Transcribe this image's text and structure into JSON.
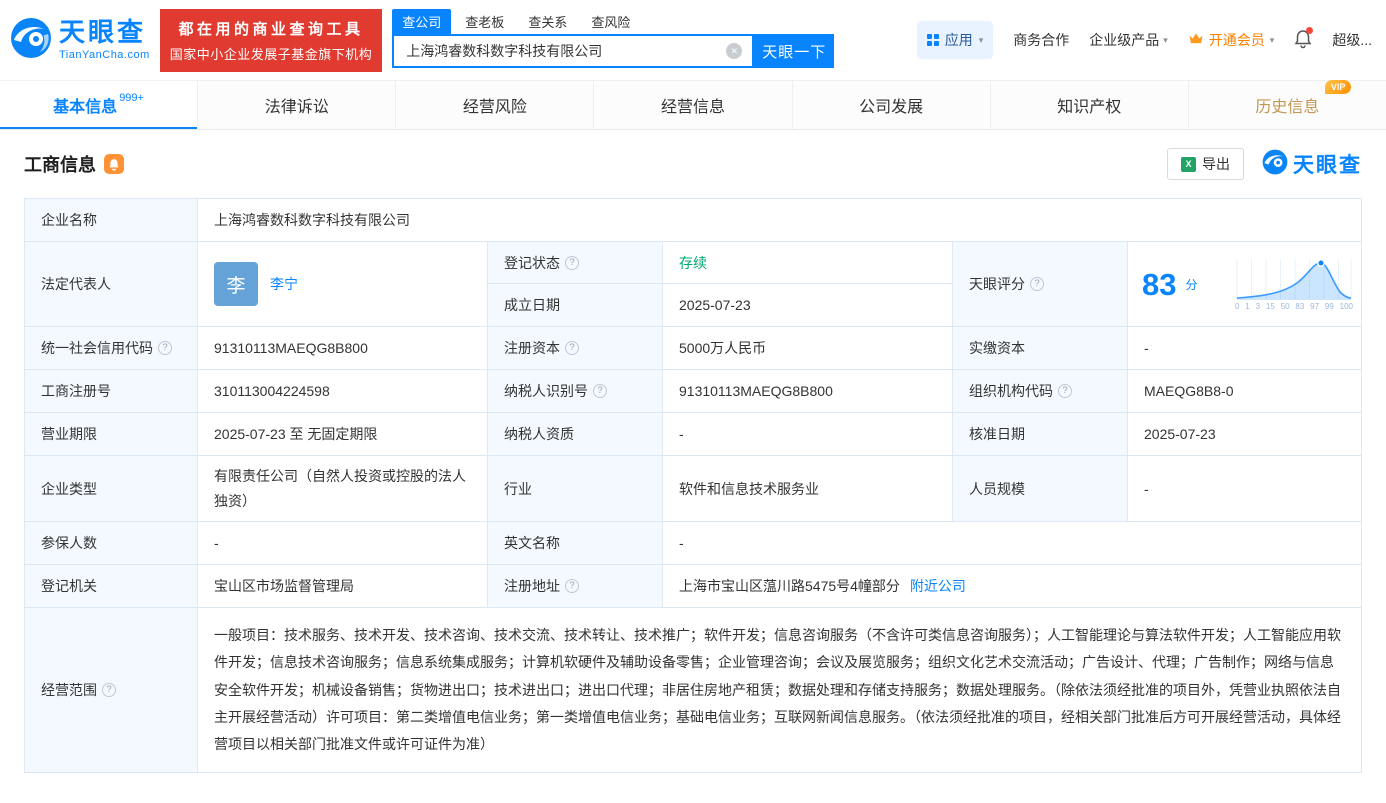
{
  "brand": {
    "name": "天眼查",
    "domain": "TianYanCha.com"
  },
  "promo": {
    "line1": "都在用的商业查询工具",
    "line2": "国家中小企业发展子基金旗下机构"
  },
  "search": {
    "tabs": [
      {
        "label": "查公司",
        "active": true
      },
      {
        "label": "查老板",
        "active": false
      },
      {
        "label": "查关系",
        "active": false
      },
      {
        "label": "查风险",
        "active": false
      }
    ],
    "value": "上海鸿睿数科数字科技有限公司",
    "button": "天眼一下"
  },
  "topmenu": {
    "apps": "应用",
    "cooperation": "商务合作",
    "enterprise": "企业级产品",
    "vip": "开通会员",
    "super": "超级..."
  },
  "nav": {
    "tabs": [
      {
        "label": "基本信息",
        "badge": "999+",
        "active": true
      },
      {
        "label": "法律诉讼"
      },
      {
        "label": "经营风险"
      },
      {
        "label": "经营信息"
      },
      {
        "label": "公司发展"
      },
      {
        "label": "知识产权"
      },
      {
        "label": "历史信息",
        "vip": "VIP"
      }
    ]
  },
  "section": {
    "title": "工商信息",
    "export": "导出",
    "brand": "天眼查"
  },
  "info": {
    "company_name": {
      "label": "企业名称",
      "value": "上海鸿睿数科数字科技有限公司"
    },
    "legal_rep": {
      "label": "法定代表人",
      "avatar": "李",
      "value": "李宁"
    },
    "reg_status": {
      "label": "登记状态",
      "value": "存续"
    },
    "establish_date": {
      "label": "成立日期",
      "value": "2025-07-23"
    },
    "score": {
      "label": "天眼评分",
      "value": "83",
      "unit": "分"
    },
    "credit_code": {
      "label": "统一社会信用代码",
      "value": "91310113MAEQG8B800"
    },
    "reg_capital": {
      "label": "注册资本",
      "value": "5000万人民币"
    },
    "paid_capital": {
      "label": "实缴资本",
      "value": "-"
    },
    "reg_no": {
      "label": "工商注册号",
      "value": "310113004224598"
    },
    "taxpayer_id": {
      "label": "纳税人识别号",
      "value": "91310113MAEQG8B800"
    },
    "org_code": {
      "label": "组织机构代码",
      "value": "MAEQG8B8-0"
    },
    "business_term": {
      "label": "营业期限",
      "value": "2025-07-23 至 无固定期限"
    },
    "taxpayer_quality": {
      "label": "纳税人资质",
      "value": "-"
    },
    "approval_date": {
      "label": "核准日期",
      "value": "2025-07-23"
    },
    "company_type": {
      "label": "企业类型",
      "value": "有限责任公司（自然人投资或控股的法人独资）"
    },
    "industry": {
      "label": "行业",
      "value": "软件和信息技术服务业"
    },
    "staff_size": {
      "label": "人员规模",
      "value": "-"
    },
    "insured_count": {
      "label": "参保人数",
      "value": "-"
    },
    "english_name": {
      "label": "英文名称",
      "value": "-"
    },
    "reg_authority": {
      "label": "登记机关",
      "value": "宝山区市场监督管理局"
    },
    "reg_address": {
      "label": "注册地址",
      "value": "上海市宝山区蕰川路5475号4幢部分",
      "link": "附近公司"
    },
    "business_scope": {
      "label": "经营范围",
      "value": "一般项目：技术服务、技术开发、技术咨询、技术交流、技术转让、技术推广；软件开发；信息咨询服务（不含许可类信息咨询服务）；人工智能理论与算法软件开发；人工智能应用软件开发；信息技术咨询服务；信息系统集成服务；计算机软硬件及辅助设备零售；企业管理咨询；会议及展览服务；组织文化艺术交流活动；广告设计、代理；广告制作；网络与信息安全软件开发；机械设备销售；货物进出口；技术进出口；进出口代理；非居住房地产租赁；数据处理和存储支持服务；数据处理服务。（除依法须经批准的项目外，凭营业执照依法自主开展经营活动）许可项目：第二类增值电信业务；第一类增值电信业务；基础电信业务；互联网新闻信息服务。（依法须经批准的项目，经相关部门批准后方可开展经营活动，具体经营项目以相关部门批准文件或许可证件为准）"
    }
  },
  "score_chart": {
    "type": "line",
    "value": 83,
    "unit": "分",
    "x_ticks": [
      "0",
      "1",
      "3",
      "15",
      "50",
      "83",
      "97",
      "99",
      "100"
    ]
  }
}
